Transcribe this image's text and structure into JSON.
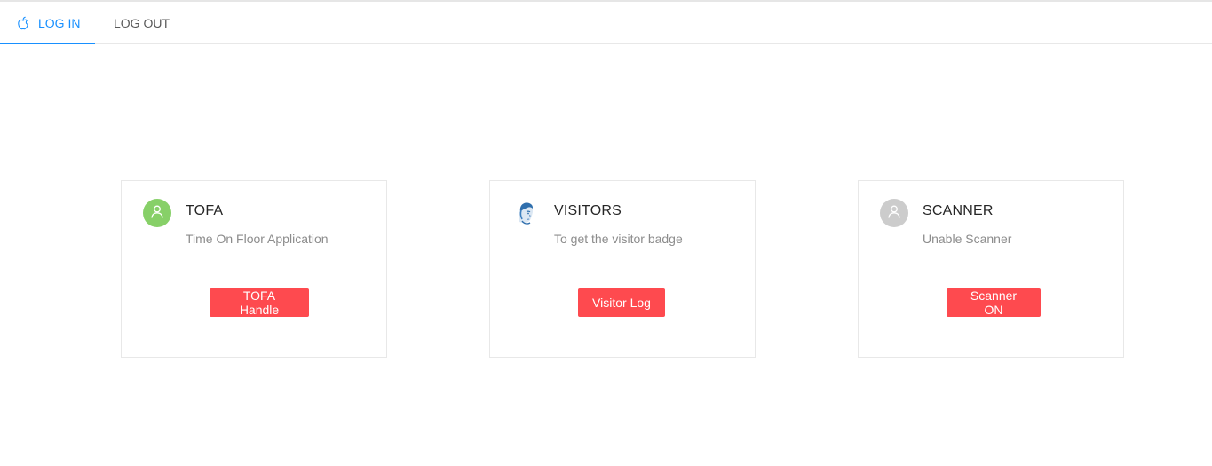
{
  "tabs": [
    {
      "label": "LOG IN",
      "icon": "apple-icon",
      "active": true
    },
    {
      "label": "LOG OUT",
      "active": false
    }
  ],
  "colors": {
    "accent": "#1890ff",
    "button": "#fe4a4f",
    "avatar_green": "#87d068",
    "avatar_grey": "#cccccc"
  },
  "cards": [
    {
      "title": "TOFA",
      "description": "Time On Floor Application",
      "button": "TOFA Handle",
      "avatar": "user-icon"
    },
    {
      "title": "VISITORS",
      "description": "To get the visitor badge",
      "button": "Visitor Log",
      "avatar": "visitor-photo"
    },
    {
      "title": "SCANNER",
      "description": "Unable Scanner",
      "button": "Scanner ON",
      "avatar": "user-icon"
    }
  ]
}
